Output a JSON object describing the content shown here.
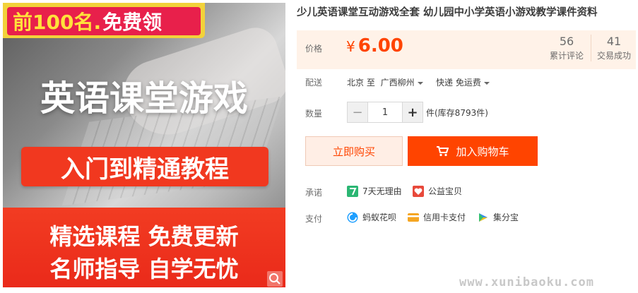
{
  "hero": {
    "badge_highlight": "前100名.",
    "badge_text": "免费领",
    "heading": "英语课堂游戏",
    "pill": "入门到精通教程",
    "line1": "精选课程 免费更新",
    "line2": "名师指导 自学无忧"
  },
  "product": {
    "title": "少儿英语课堂互动游戏全套 幼儿园中小学英语小游戏教学课件资料"
  },
  "price": {
    "label": "价格",
    "currency": "¥",
    "value": "6.00",
    "reviews_count": "56",
    "reviews_label": "累计评论",
    "sales_count": "41",
    "sales_label": "交易成功"
  },
  "delivery": {
    "label": "配送",
    "from": "北京 至",
    "to": "广西柳州",
    "shipping": "快递 免运费"
  },
  "quantity": {
    "label": "数量",
    "minus": "−",
    "value": "1",
    "plus": "+",
    "stock": "件(库存8793件)"
  },
  "actions": {
    "buy_now": "立即购买",
    "add_to_cart": "加入购物车"
  },
  "promise": {
    "label": "承诺",
    "items": [
      "7天无理由",
      "公益宝贝"
    ]
  },
  "payment": {
    "label": "支付",
    "items": [
      "蚂蚁花呗",
      "信用卡支付",
      "集分宝"
    ]
  },
  "watermark": "www.xunibaoku.com",
  "colors": {
    "accent": "#ff4400",
    "price_bg": "#fff2e8",
    "hero_red": "#f1381f",
    "badge_yellow": "#f2d23a"
  }
}
